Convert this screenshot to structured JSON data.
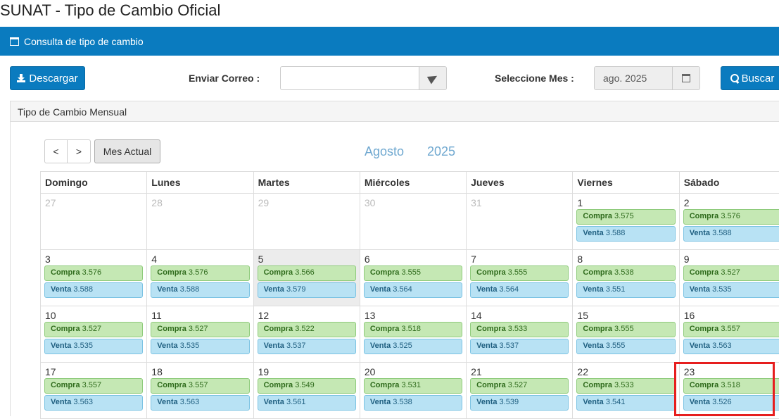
{
  "page": {
    "title": "SUNAT - Tipo de Cambio Oficial"
  },
  "header": {
    "title": "Consulta de tipo de cambio"
  },
  "toolbar": {
    "download_label": "Descargar",
    "email_label": "Enviar Correo :",
    "email_value": "",
    "month_label": "Seleccione Mes :",
    "month_value": "ago. 2025",
    "search_label": "Buscar"
  },
  "panel": {
    "title": "Tipo de Cambio Mensual"
  },
  "calendar": {
    "prev_label": "<",
    "next_label": ">",
    "today_label": "Mes Actual",
    "month": "Agosto",
    "year": "2025",
    "buy_label": "Compra",
    "sell_label": "Venta",
    "weekdays": [
      "Domingo",
      "Lunes",
      "Martes",
      "Miércoles",
      "Jueves",
      "Viernes",
      "Sábado"
    ],
    "weeks": [
      [
        {
          "day": "27",
          "other": true
        },
        {
          "day": "28",
          "other": true
        },
        {
          "day": "29",
          "other": true
        },
        {
          "day": "30",
          "other": true
        },
        {
          "day": "31",
          "other": true
        },
        {
          "day": "1",
          "buy": "3.575",
          "sell": "3.588"
        },
        {
          "day": "2",
          "buy": "3.576",
          "sell": "3.588"
        }
      ],
      [
        {
          "day": "3",
          "buy": "3.576",
          "sell": "3.588"
        },
        {
          "day": "4",
          "buy": "3.576",
          "sell": "3.588"
        },
        {
          "day": "5",
          "buy": "3.566",
          "sell": "3.579",
          "today": true
        },
        {
          "day": "6",
          "buy": "3.555",
          "sell": "3.564"
        },
        {
          "day": "7",
          "buy": "3.555",
          "sell": "3.564"
        },
        {
          "day": "8",
          "buy": "3.538",
          "sell": "3.551"
        },
        {
          "day": "9",
          "buy": "3.527",
          "sell": "3.535"
        }
      ],
      [
        {
          "day": "10",
          "buy": "3.527",
          "sell": "3.535"
        },
        {
          "day": "11",
          "buy": "3.527",
          "sell": "3.535"
        },
        {
          "day": "12",
          "buy": "3.522",
          "sell": "3.537"
        },
        {
          "day": "13",
          "buy": "3.518",
          "sell": "3.525"
        },
        {
          "day": "14",
          "buy": "3.533",
          "sell": "3.537"
        },
        {
          "day": "15",
          "buy": "3.555",
          "sell": "3.555"
        },
        {
          "day": "16",
          "buy": "3.557",
          "sell": "3.563"
        }
      ],
      [
        {
          "day": "17",
          "buy": "3.557",
          "sell": "3.563"
        },
        {
          "day": "18",
          "buy": "3.557",
          "sell": "3.563"
        },
        {
          "day": "19",
          "buy": "3.549",
          "sell": "3.561"
        },
        {
          "day": "20",
          "buy": "3.531",
          "sell": "3.538"
        },
        {
          "day": "21",
          "buy": "3.527",
          "sell": "3.539"
        },
        {
          "day": "22",
          "buy": "3.533",
          "sell": "3.541"
        },
        {
          "day": "23",
          "buy": "3.518",
          "sell": "3.526"
        }
      ]
    ]
  },
  "colors": {
    "primary": "#0a7bbf",
    "buy": "#c5e8b4",
    "sell": "#b8e2f4",
    "highlight": "#e61e1e"
  }
}
